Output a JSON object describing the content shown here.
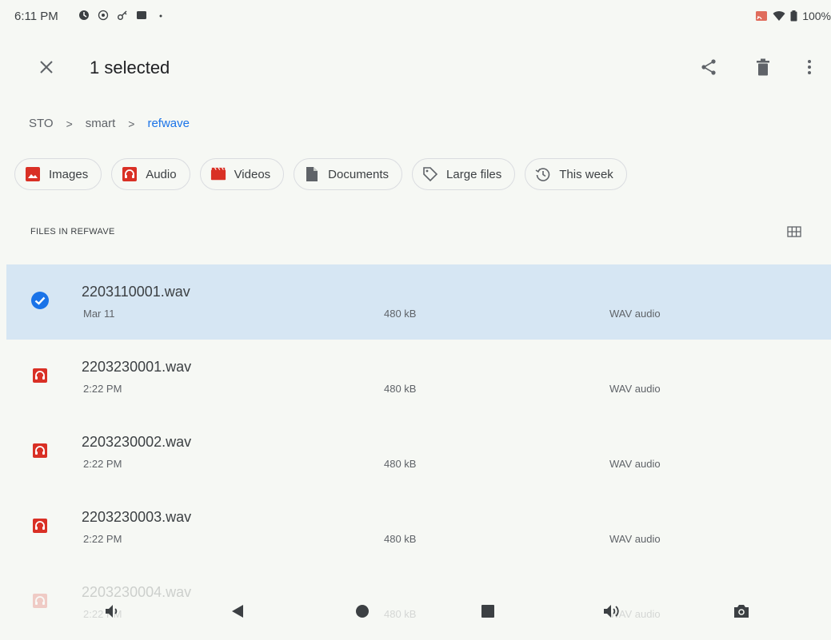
{
  "status_bar": {
    "time": "6:11 PM",
    "battery": "100%",
    "icons": [
      "app-icon",
      "target-icon",
      "key-icon",
      "square-icon",
      "dot-icon"
    ]
  },
  "appbar": {
    "title": "1 selected",
    "actions": [
      "share-icon",
      "delete-icon",
      "more-vert-icon"
    ]
  },
  "breadcrumb": [
    "STO",
    "smart",
    "refwave"
  ],
  "chips": [
    {
      "label": "Images",
      "icon": "image-icon",
      "color": "#d93025"
    },
    {
      "label": "Audio",
      "icon": "audio-icon",
      "color": "#d93025"
    },
    {
      "label": "Videos",
      "icon": "video-icon",
      "color": "#d93025"
    },
    {
      "label": "Documents",
      "icon": "document-icon",
      "color": "#5f6368"
    },
    {
      "label": "Large files",
      "icon": "tag-icon",
      "color": "#5f6368"
    },
    {
      "label": "This week",
      "icon": "history-icon",
      "color": "#5f6368"
    }
  ],
  "section": {
    "header": "FILES IN REFWAVE"
  },
  "files": [
    {
      "name": "2203110001.wav",
      "date": "Mar 11",
      "size": "480 kB",
      "type": "WAV audio",
      "selected": true
    },
    {
      "name": "2203230001.wav",
      "date": "2:22 PM",
      "size": "480 kB",
      "type": "WAV audio",
      "selected": false
    },
    {
      "name": "2203230002.wav",
      "date": "2:22 PM",
      "size": "480 kB",
      "type": "WAV audio",
      "selected": false
    },
    {
      "name": "2203230003.wav",
      "date": "2:22 PM",
      "size": "480 kB",
      "type": "WAV audio",
      "selected": false
    },
    {
      "name": "2203230004.wav",
      "date": "2:22 PM",
      "size": "480 kB",
      "type": "WAV audio",
      "selected": false
    }
  ],
  "colors": {
    "accent": "#1a73e8",
    "selected_row": "#d6e6f3",
    "audio_icon": "#d93025"
  }
}
